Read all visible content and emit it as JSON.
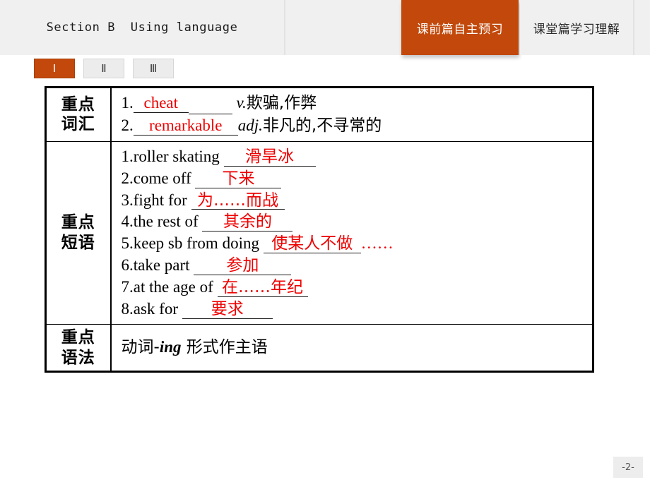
{
  "header": {
    "section_title": "Section B  Using language",
    "tabs": [
      {
        "label": "课前篇自主预习",
        "active": true
      },
      {
        "label": "课堂篇学习理解",
        "active": false
      }
    ],
    "accent_color": "#c2490b",
    "bar_color": "#f0f0f0"
  },
  "pills": [
    {
      "label": "Ⅰ",
      "active": true
    },
    {
      "label": "Ⅱ",
      "active": false
    },
    {
      "label": "Ⅲ",
      "active": false
    }
  ],
  "table": {
    "rows": [
      {
        "label_lines": [
          "重点",
          "词汇"
        ],
        "type": "vocab",
        "items": [
          {
            "num": "1.",
            "answer": "cheat",
            "blank_width": 62,
            "pos": "v.",
            "meaning": "欺骗,作弊",
            "answer_width": 78
          },
          {
            "num": "2.",
            "answer": "remarkable",
            "blank_width": 0,
            "pos": "adj.",
            "meaning": "非凡的,不寻常的",
            "answer_width": 148
          }
        ]
      },
      {
        "label_lines": [
          "重点",
          "短语"
        ],
        "type": "phrase",
        "items": [
          {
            "num": "1.",
            "english": "roller skating",
            "answer": "滑旱冰",
            "answer_width": 130,
            "trailing_dots": ""
          },
          {
            "num": "2.",
            "english": "come off",
            "answer": "下来",
            "answer_width": 122,
            "trailing_dots": ""
          },
          {
            "num": "3.",
            "english": "fight for",
            "answer": "为……而战",
            "answer_width": 132,
            "trailing_dots": ""
          },
          {
            "num": "4.",
            "english": "the rest of",
            "answer": "其余的",
            "answer_width": 128,
            "trailing_dots": ""
          },
          {
            "num": "5.",
            "english": "keep sb from doing",
            "answer": "使某人不做",
            "answer_width": 138,
            "trailing_dots": "……"
          },
          {
            "num": "6.",
            "english": "take part",
            "answer": "参加",
            "answer_width": 138,
            "trailing_dots": ""
          },
          {
            "num": "7.",
            "english": "at the age of",
            "answer": "在……年纪",
            "answer_width": 128,
            "trailing_dots": ""
          },
          {
            "num": "8.",
            "english": "ask for",
            "answer": "要求",
            "answer_width": 128,
            "trailing_dots": ""
          }
        ]
      },
      {
        "label_lines": [
          "重点",
          "语法"
        ],
        "type": "grammar",
        "text_before": "动词-",
        "text_italic": "ing",
        "text_after": " 形式作主语"
      }
    ]
  },
  "footer": {
    "page_number": "-2-"
  }
}
